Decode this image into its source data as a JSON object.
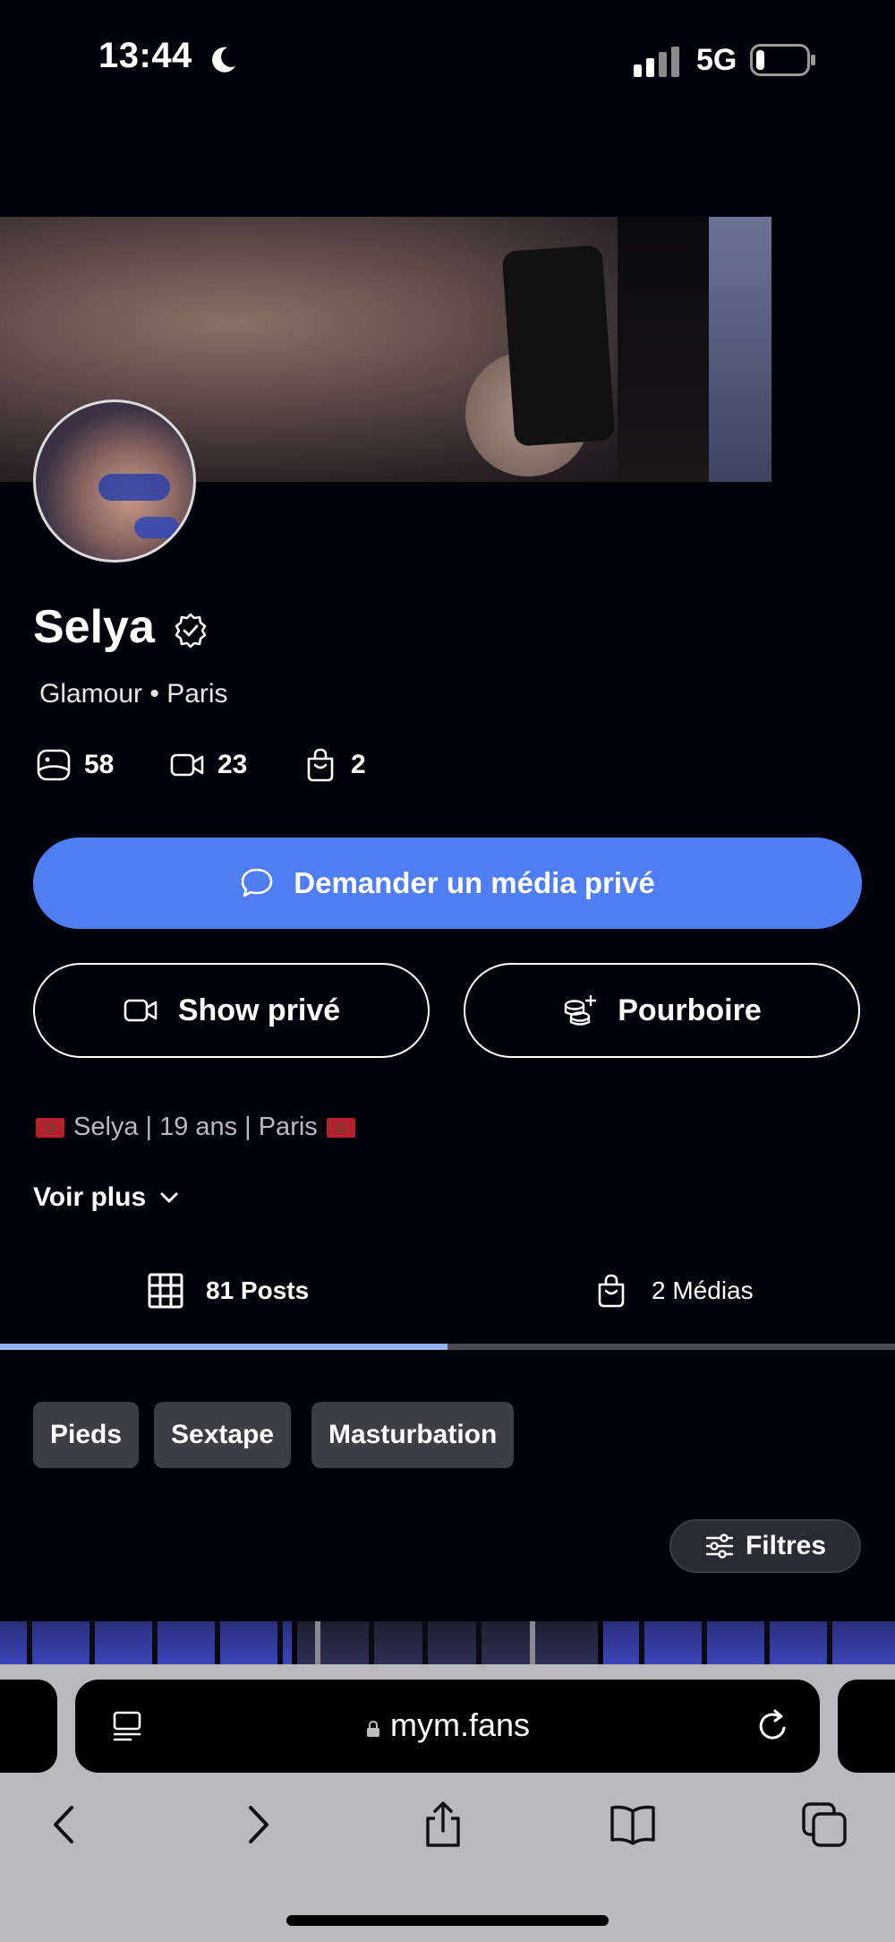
{
  "status_bar": {
    "time": "13:44",
    "network": "5G",
    "icons": [
      "moon-icon",
      "signal-icon",
      "battery-icon"
    ]
  },
  "profile": {
    "name": "Selya",
    "subtitle": "Glamour • Paris",
    "stats": {
      "photos": "58",
      "videos": "23",
      "medias": "2"
    }
  },
  "actions": {
    "request_private_media": "Demander un média privé",
    "private_show": "Show privé",
    "tip": "Pourboire"
  },
  "bio": {
    "name": "Selya",
    "age": "19 ans",
    "city": "Paris",
    "separator": "|"
  },
  "see_more": "Voir plus",
  "tabs": {
    "posts": "81 Posts",
    "medias": "2 Médias",
    "active": "posts"
  },
  "chips": [
    "Pieds",
    "Sextape",
    "Masturbation"
  ],
  "filters": "Filtres",
  "browser": {
    "url": "mym.fans"
  },
  "colors": {
    "accent": "#4f7ef2",
    "background": "#02020c",
    "tab_indicator": "#94b4f4",
    "chip_bg": "#3d3d44",
    "chrome_bg": "#b9b9be"
  }
}
